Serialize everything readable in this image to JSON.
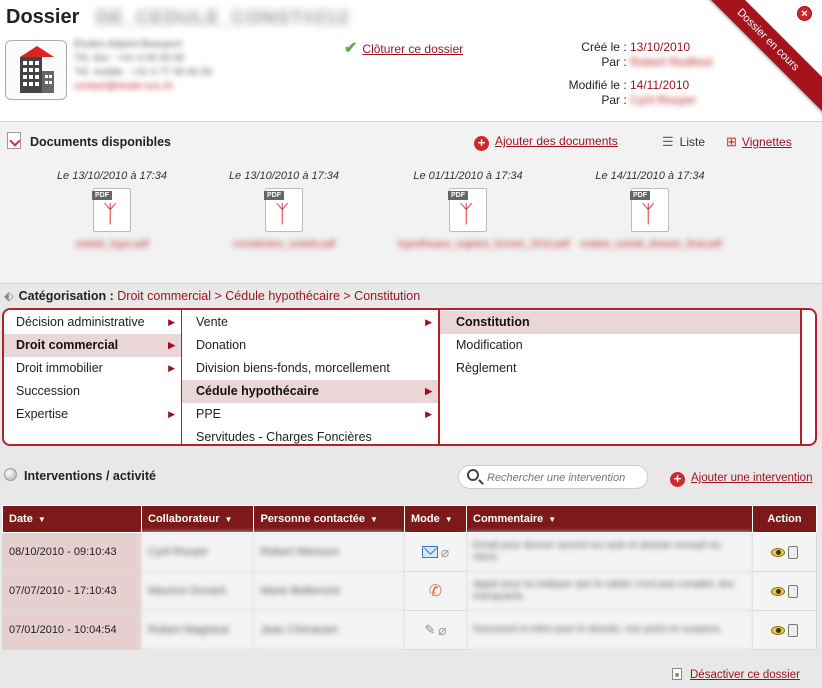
{
  "header": {
    "title": "Dossier",
    "dossier_ref": "DE_CEDULE_CONST#212",
    "contact_lines": [
      "Études Adjoint-Beauport",
      "Tél. fixe : +41 0 00 00 00",
      "Tél. mobile : +41 0 77 00 00 00",
      "contact@etude-xxx.ch"
    ],
    "close_label": "Clôturer ce dossier",
    "created_label": "Créé le :",
    "created_value": "13/10/2010",
    "by_label": "Par :",
    "created_by": "Robert Redford",
    "modified_label": "Modifié le :",
    "modified_value": "14/11/2010",
    "modified_by": "Cyril Rouyer",
    "ribbon": "Dossier en cours"
  },
  "documents": {
    "title": "Documents disponibles",
    "add_label": "Ajouter des documents",
    "view_list": "Liste",
    "view_grid": "Vignettes",
    "items": [
      {
        "date": "Le 13/10/2010 à 17:34",
        "name": "cedule_hypo.pdf"
      },
      {
        "date": "Le 13/10/2010 à 17:34",
        "name": "constitution_cedule.pdf"
      },
      {
        "date": "Le 01/11/2010 à 17:34",
        "name": "hypotheque_registre_foncier_2010.pdf"
      },
      {
        "date": "Le 14/11/2010 à 17:34",
        "name": "notaire_extrait_dossier_final.pdf"
      }
    ]
  },
  "categorisation": {
    "label": "Catégorisation :",
    "path": "Droit commercial > Cédule hypothécaire > Constitution",
    "col1": [
      "Décision administrative",
      "Droit commercial",
      "Droit immobilier",
      "Succession",
      "Expertise"
    ],
    "col2": [
      "Vente",
      "Donation",
      "Division biens-fonds, morcellement",
      "Cédule hypothécaire",
      "PPE",
      "Servitudes - Charges Foncières"
    ],
    "col3": [
      "Constitution",
      "Modification",
      "Règlement"
    ]
  },
  "interventions": {
    "title": "Interventions / activité",
    "search_placeholder": "Rechercher une intervention",
    "add_label": "Ajouter une intervention",
    "columns": [
      "Date",
      "Collaborateur",
      "Personne contactée",
      "Mode",
      "Commentaire",
      "Action"
    ],
    "rows": [
      {
        "date": "08/10/2010 - 09:10:43",
        "collab": "Cyril Rouyer",
        "contact": "Robert Ménouni",
        "comment": "Email pour donner accord sur acte et dossier envoyé au client."
      },
      {
        "date": "07/07/2010 - 17:10:43",
        "collab": "Maurice Dunant",
        "contact": "Marie Bellemont",
        "comment": "Appel pour lui indiquer que le cahier n'est pas complet, doc manquants."
      },
      {
        "date": "07/01/2010 - 10:04:54",
        "collab": "Robert Magistral",
        "contact": "Jean Chimaram",
        "comment": "Document à relire pour le dossier, voir point en suspens."
      }
    ]
  },
  "footer": {
    "deactivate_label": "Désactiver ce dossier"
  },
  "colors": {
    "accent": "#9b111e",
    "ribbon": "#a4141c",
    "table_header": "#7c1a1a",
    "selected_row": "#ead6d6"
  }
}
